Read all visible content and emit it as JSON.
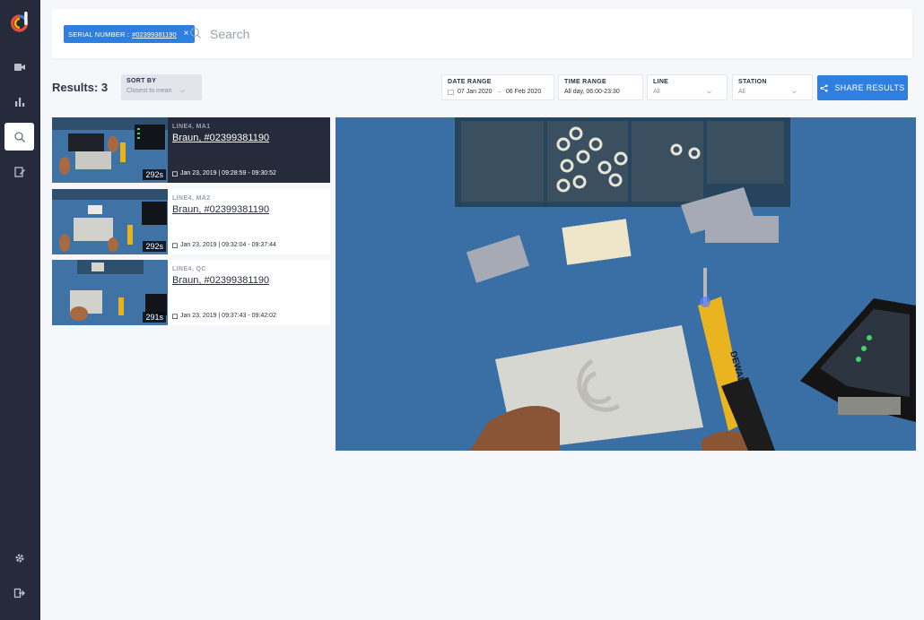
{
  "sidebar": {
    "items": [
      {
        "icon": "video-camera-icon"
      },
      {
        "icon": "bar-chart-icon"
      },
      {
        "icon": "search-icon",
        "active": true
      },
      {
        "icon": "edit-icon"
      }
    ],
    "bottom": [
      {
        "icon": "gear-icon"
      },
      {
        "icon": "logout-icon"
      }
    ]
  },
  "search": {
    "chip_key": "SERIAL NUMBER :",
    "chip_value": "#02399381190",
    "chip_close": "×",
    "placeholder": "Search"
  },
  "toolbar": {
    "results_label": "Results: 3",
    "sort_label": "SORT BY",
    "sort_value": "Closest to mean",
    "date_label": "DATE RANGE",
    "date_from": "07 Jan 2020",
    "date_to": "06 Feb 2020",
    "time_label": "TIME RANGE",
    "time_value": "All day, 06:00-23:30",
    "line_label": "LINE",
    "line_value": "All",
    "station_label": "STATION",
    "station_value": "All",
    "share_label": "SHARE RESULTS",
    "accent": "#2f7fe0"
  },
  "results": [
    {
      "line": "LINE4, MA1",
      "title": "Braun, #02399381190",
      "time": "Jan 23, 2019 | 09:28:59 - 09:30:52",
      "duration": "292s"
    },
    {
      "line": "LINE4, MA2",
      "title": "Braun, #02399381190",
      "time": "Jan 23, 2019 | 09:32:04 - 09:37:44",
      "duration": "292s"
    },
    {
      "line": "LINE4, QC",
      "title": "Braun, #02399381190",
      "time": "Jan 23, 2019 | 09:37:43 - 09:42:02",
      "duration": "291s"
    }
  ],
  "video": {
    "tool_brand": "DEWALT"
  }
}
